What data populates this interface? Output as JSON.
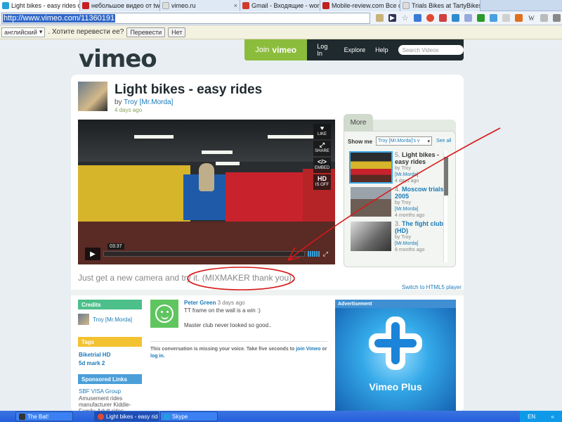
{
  "browser": {
    "tabs": [
      {
        "label": "Light bikes - easy rides on ...",
        "active": true,
        "favicon_color": "#2aa0d8"
      },
      {
        "label": "небольшое видео от two ...",
        "active": false,
        "favicon_color": "#c82020"
      },
      {
        "label": "vimeo.ru",
        "active": false,
        "favicon_color": "#dddddd"
      },
      {
        "label": "Gmail - Входящие - worka...",
        "active": false,
        "favicon_color": "#d03b2b"
      },
      {
        "label": "Mobile-review.com Все о м...",
        "active": false,
        "favicon_color": "#c02020"
      },
      {
        "label": "Trials Bikes at TartyBikes - ...",
        "active": false,
        "favicon_color": "#dddddd"
      }
    ],
    "url": "http://www.vimeo.com/11360191"
  },
  "translate_bar": {
    "language": "английский",
    "prompt": ". Хотите перевести ее?",
    "translate_button": "Перевести",
    "no_button": "Нет"
  },
  "vimeo": {
    "logo": "vimeo",
    "nav": {
      "join_prefix": "Join",
      "join_brand": "vimeo",
      "login": "Log In",
      "explore": "Explore",
      "help": "Help",
      "search_placeholder": "Search Videos"
    },
    "video": {
      "title": "Light bikes - easy rides",
      "by_prefix": "by",
      "author": "Troy [Mr.Morda]",
      "posted": "4 days ago",
      "current_time": "03:37",
      "buttons": {
        "like": "LIKE",
        "share": "SHARE",
        "embed": "EMBED",
        "hd": "HD",
        "hd_sub": "IS OFF"
      },
      "description": "Just get a new camera and try it. (MIXMAKER thank you).",
      "html5_link": "Switch to HTML5 player"
    },
    "more": {
      "tab": "More",
      "show_me_label": "Show me",
      "show_me_value": "Troy [Mr.Morda]'s v",
      "see_all": "See all",
      "items": [
        {
          "num": "5.",
          "title": "Light bikes - easy rides",
          "by": "by Troy",
          "author": "[Mr.Morda]",
          "ago": "4 days ago",
          "current": true
        },
        {
          "num": "4.",
          "title": "Moscow trials 2005",
          "by": "by Troy",
          "author": "[Mr.Morda]",
          "ago": "4 months ago",
          "current": false
        },
        {
          "num": "3.",
          "title": "The fight club (HD)",
          "by": "by Troy",
          "author": "[Mr.Morda]",
          "ago": "8 months ago",
          "current": false
        }
      ]
    },
    "credits": {
      "heading": "Credits",
      "name": "Troy [Mr.Morda]"
    },
    "tags": {
      "heading": "Tags",
      "items": [
        "Biketrial HD",
        "5d mark 2"
      ]
    },
    "sponsored": {
      "heading": "Sponsored Links",
      "title": "SBF VISA Group",
      "text": "Amusement rides manufacturer Kiddie-Family-Adult rides"
    },
    "comment": {
      "author": "Peter Green",
      "ago": "3 days ago",
      "line1": "TT frame on the wall is a win :)",
      "line2": "Master club never looked so good.."
    },
    "missing_voice": {
      "text": "This conversation is missing your voice. Take five seconds to",
      "join_link": "join Vimeo",
      "or": "or",
      "login_link": "log in"
    },
    "ad": {
      "heading": "Advertisement",
      "text": "Vimeo Plus"
    }
  },
  "taskbar": {
    "items": [
      {
        "label": "The Bat!",
        "active": false
      },
      {
        "label": "Light bikes - easy ride...",
        "active": true
      },
      {
        "label": "Skype",
        "active": false
      }
    ],
    "lang": "EN"
  }
}
